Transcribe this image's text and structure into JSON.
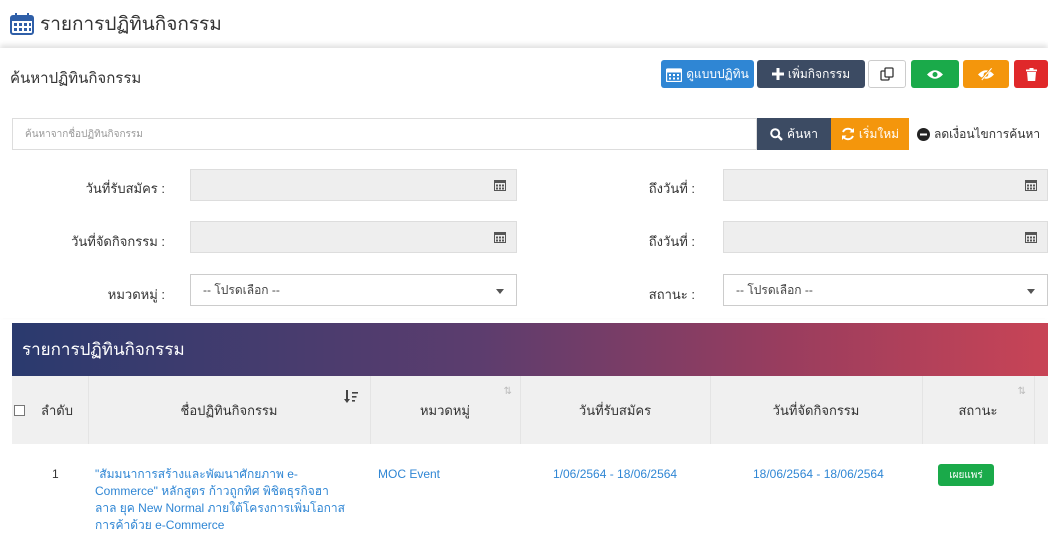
{
  "header": {
    "title": "รายการปฏิทินกิจกรรม"
  },
  "search_panel": {
    "title": "ค้นหาปฏิทินกิจกรรม",
    "buttons": {
      "view_calendar": "ดูแบบปฏิทิน",
      "add_activity": "เพิ่มกิจกรรม"
    },
    "search": {
      "placeholder": "ค้นหาจากชื่อปฏิทินกิจกรรม",
      "search_label": "ค้นหา",
      "reset_label": "เริ่มใหม่",
      "reduce_label": "ลดเงื่อนไขการค้นหา"
    },
    "filters": {
      "register_date_label": "วันที่รับสมัคร :",
      "register_to_label": "ถึงวันที่ :",
      "event_date_label": "วันที่จัดกิจกรรม :",
      "event_to_label": "ถึงวันที่ :",
      "category_label": "หมวดหมู่ :",
      "category_value": "-- โปรดเลือก --",
      "status_label": "สถานะ :",
      "status_value": "-- โปรดเลือก --"
    }
  },
  "list": {
    "title": "รายการปฏิทินกิจกรรม",
    "columns": [
      "ลำดับ",
      "ชื่อปฏิทินกิจกรรม",
      "หมวดหมู่",
      "วันที่รับสมัคร",
      "วันที่จัดกิจกรรม",
      "สถานะ"
    ],
    "rows": [
      {
        "no": "1",
        "name": "\"สัมมนาการสร้างและพัฒนาศักยภาพ e-Commerce\" หลักสูตร ก้าวถูกทิศ พิชิตธุรกิจฮาลาล ยุค New Normal ภายใต้โครงการเพิ่มโอกาสการค้าด้วย e-Commerce",
        "category": "MOC Event",
        "register_period": "1/06/2564 - 18/06/2564",
        "event_period": "18/06/2564 - 18/06/2564",
        "status": "เผยแพร่"
      }
    ]
  },
  "colors": {
    "blue": "#2f86d4",
    "navy": "#3c4b63",
    "green": "#1aaa4a",
    "orange": "#f4960c",
    "red": "#e0282a",
    "gradient_start": "#2a3a6e",
    "gradient_end": "#c84456"
  }
}
